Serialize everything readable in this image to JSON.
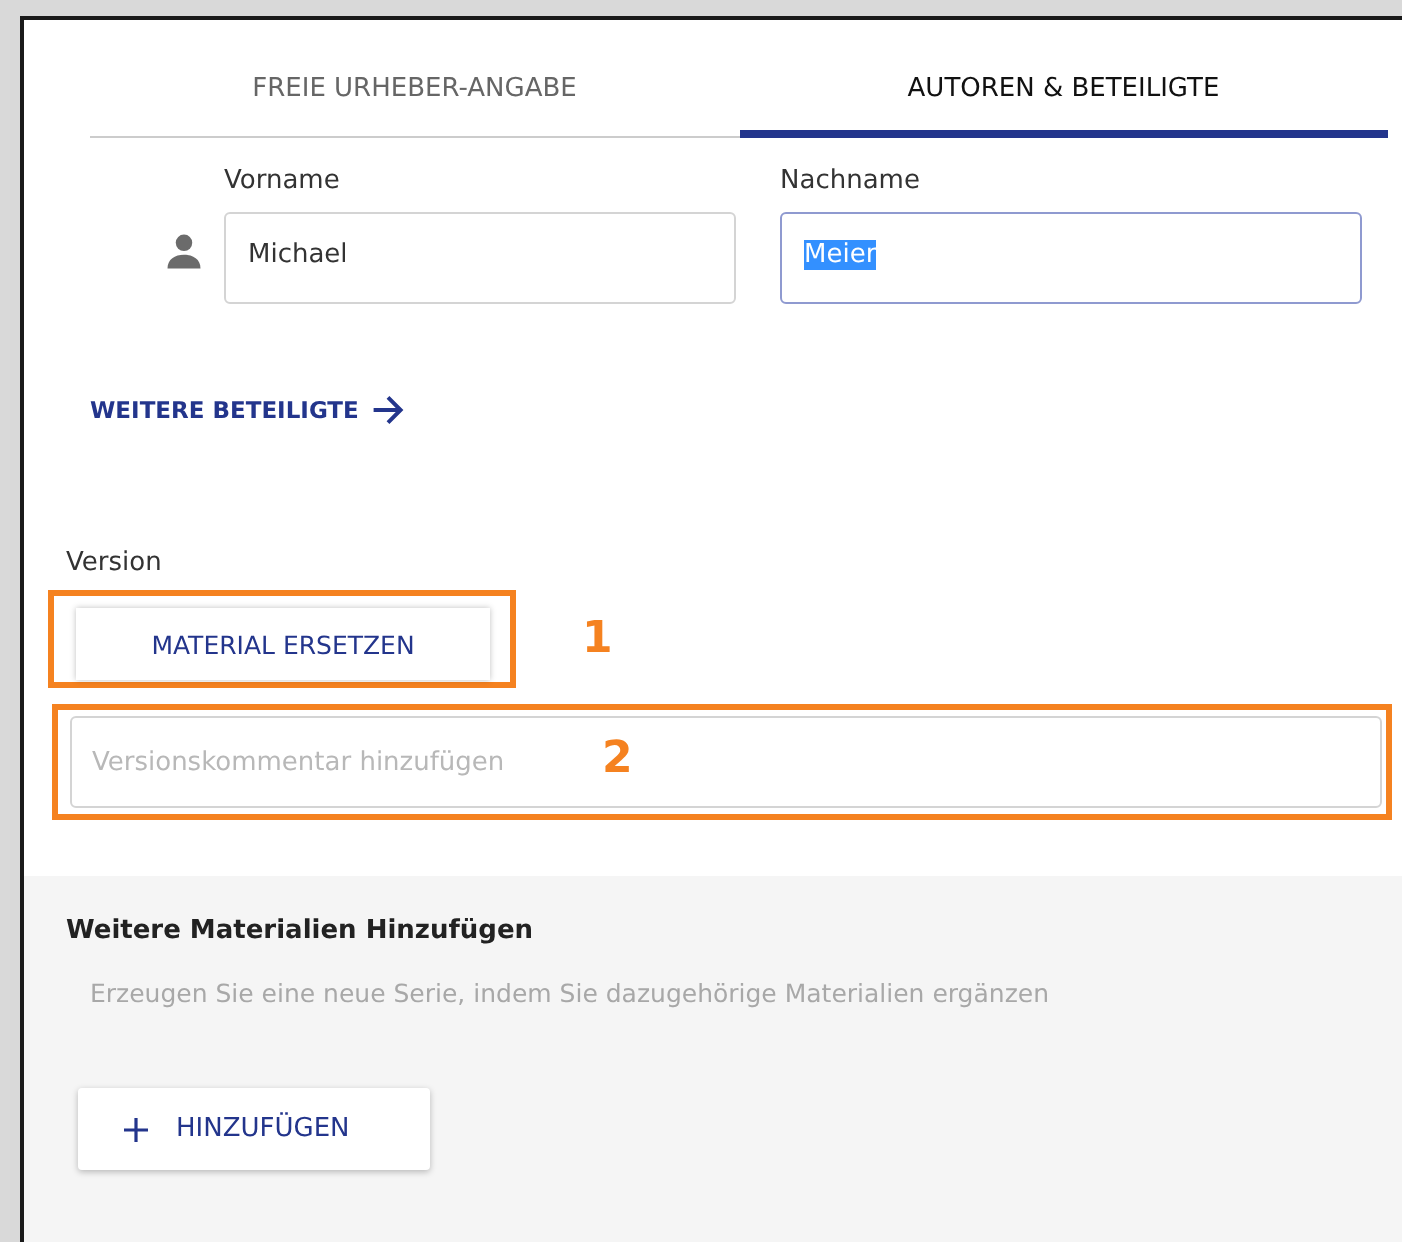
{
  "tabs": [
    {
      "label": "FREIE URHEBER-ANGABE",
      "selected": false
    },
    {
      "label": "AUTOREN & BETEILIGTE",
      "selected": true
    }
  ],
  "name_fields": [
    {
      "label": "Vorname",
      "value": "Michael",
      "focused": false,
      "text_selected": false
    },
    {
      "label": "Nachname",
      "value": "Meier",
      "focused": true,
      "text_selected": true
    }
  ],
  "more_contributors_link": "WEITERE BETEILIGTE",
  "version": {
    "label": "Version",
    "replace_button": "MATERIAL ERSETZEN",
    "comment_placeholder": "Versionskommentar hinzufügen"
  },
  "annotations": [
    "1",
    "2"
  ],
  "more_materials": {
    "title": "Weitere Materialien Hinzufügen",
    "description": "Erzeugen Sie eine neue Serie, indem Sie dazugehörige Materialien ergänzen",
    "add_button": "HINZUFÜGEN"
  }
}
